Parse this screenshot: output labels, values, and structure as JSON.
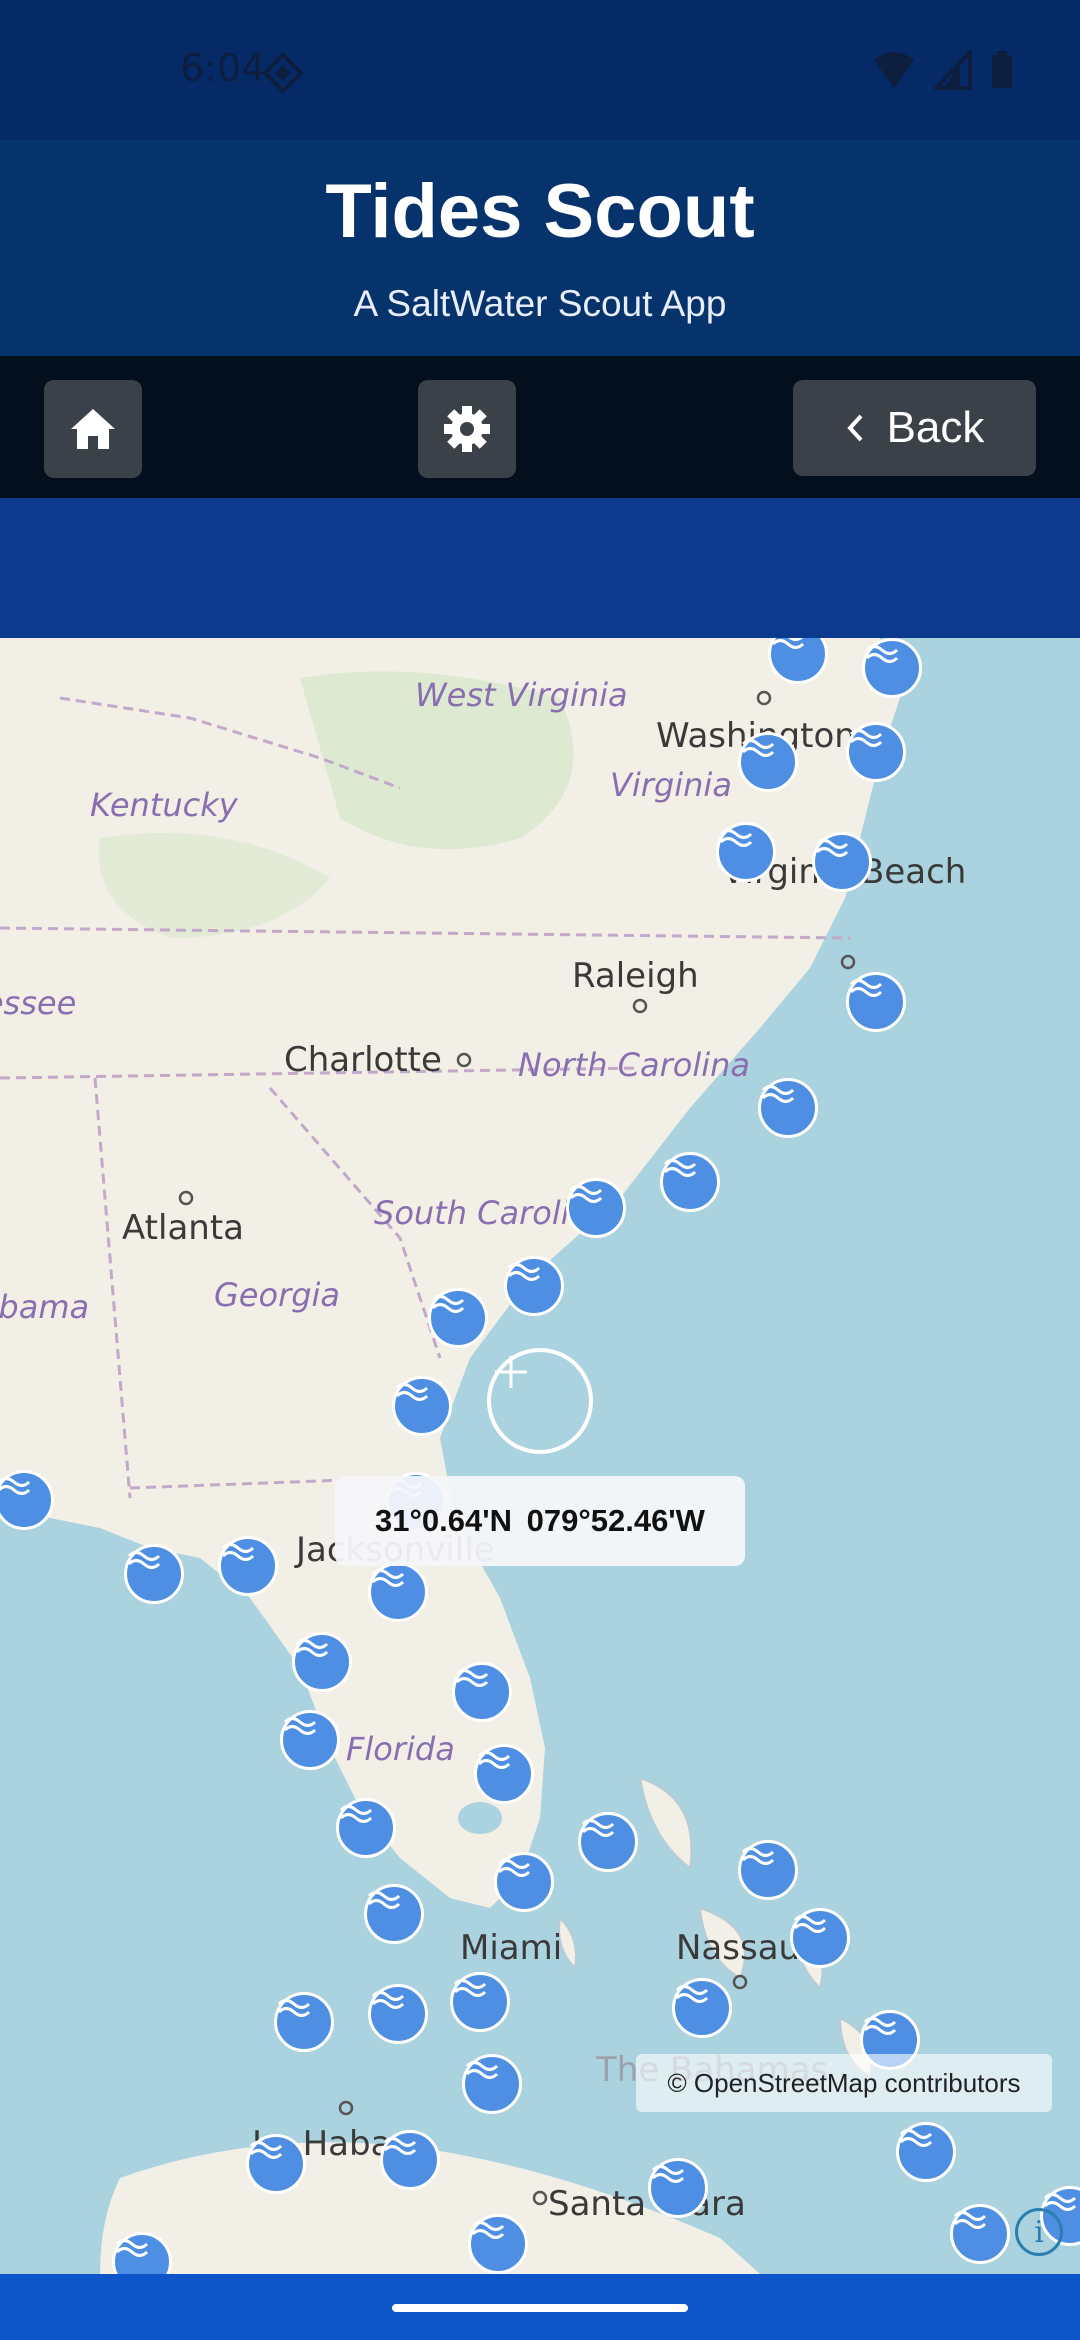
{
  "status": {
    "time": "6:04"
  },
  "header": {
    "title": "Tides Scout",
    "subtitle": "A SaltWater Scout App"
  },
  "toolbar": {
    "back_label": "Back"
  },
  "map": {
    "labels": {
      "west_virginia": "West Virginia",
      "washington": "Washington",
      "virginia": "Virginia",
      "kentucky": "Kentucky",
      "virginia_beach": "Virginia Beach",
      "tennessee": "Tennessee",
      "raleigh": "Raleigh",
      "charlotte": "Charlotte",
      "north_carolina": "North Carolina",
      "atlanta": "Atlanta",
      "south_carolina": "South Carolina",
      "georgia": "Georgia",
      "alabama": "Alabama",
      "jacksonville": "Jacksonville",
      "florida": "Florida",
      "miami": "Miami",
      "nassau": "Nassau",
      "the_bahamas": "The Bahamas",
      "la_habana": "La Habana",
      "santa_clara": "Santa Clara"
    },
    "coordinates": "31°0.64'N  079°52.46'W",
    "attribution": "© OpenStreetMap contributors",
    "info_glyph": "i",
    "tide_station_icon": "tide-wave-icon"
  }
}
